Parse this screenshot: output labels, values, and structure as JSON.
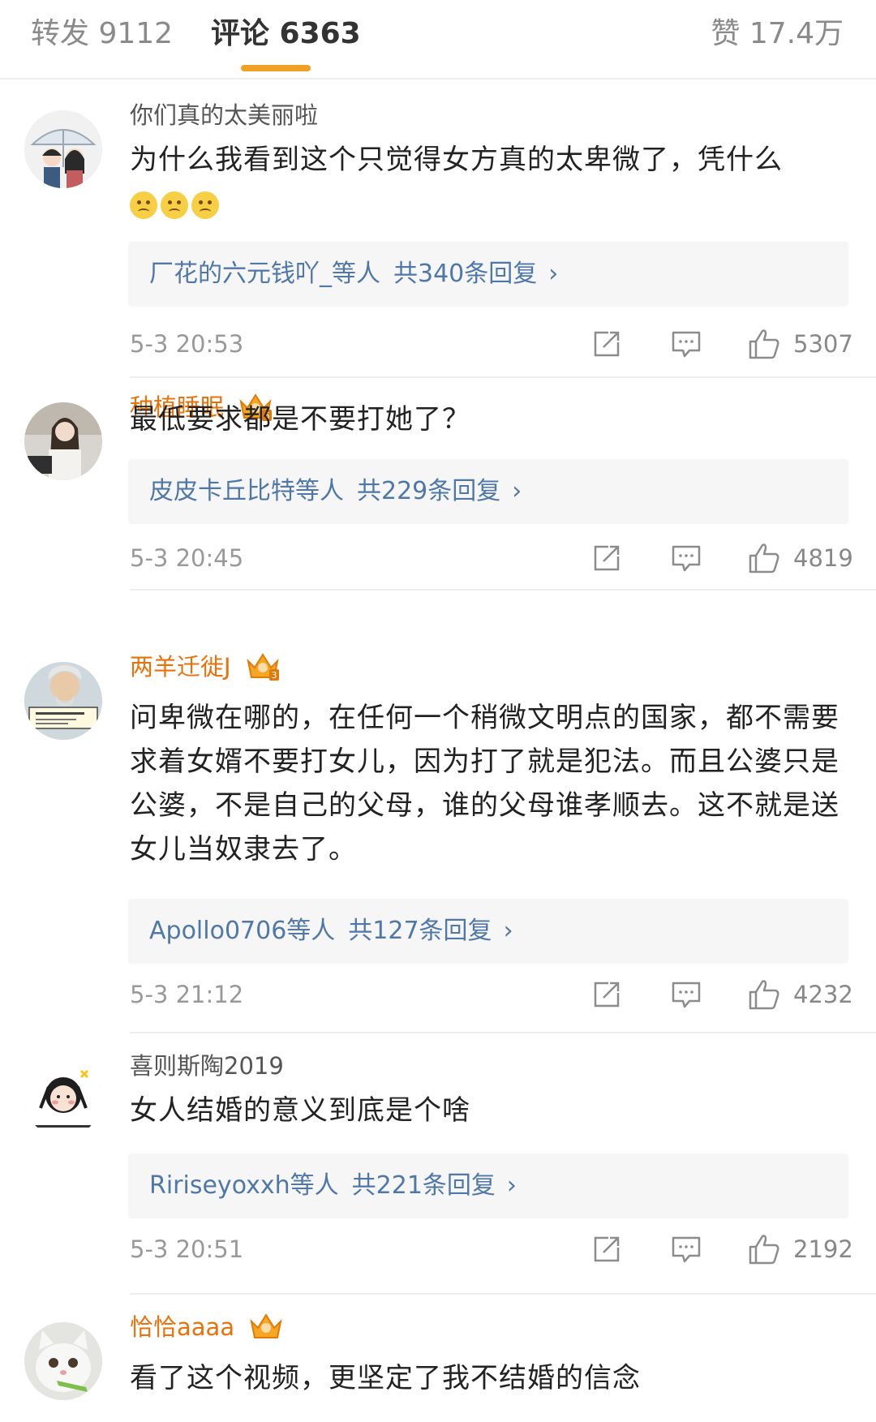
{
  "tabs": {
    "repost": "转发 9112",
    "comments": "评论 6363",
    "likes": "赞 17.4万"
  },
  "comments": [
    {
      "username": "你们真的太美丽啦",
      "vip": false,
      "text": "为什么我看到这个只觉得女方真的太卑微了，凭什么",
      "emoji": [
        "sad-emoji",
        "sad-emoji",
        "sad-emoji"
      ],
      "reply_users": "厂花的六元钱吖_等人",
      "reply_count": "共340条回复",
      "time": "5-3 20:53",
      "likes": "5307"
    },
    {
      "username": "种植睡眠",
      "vip": true,
      "vip_level": "6",
      "text": "最低要求都是不要打她了？",
      "reply_users": "皮皮卡丘比特等人",
      "reply_count": "共229条回复",
      "time": "5-3 20:45",
      "likes": "4819"
    },
    {
      "username": "两羊迁徙J",
      "vip": true,
      "vip_level": "3",
      "text": "问卑微在哪的，在任何一个稍微文明点的国家，都不需要求着女婿不要打女儿，因为打了就是犯法。而且公婆只是公婆，不是自己的父母，谁的父母谁孝顺去。这不就是送女儿当奴隶去了。",
      "reply_users": "Apollo0706等人",
      "reply_count": "共127条回复",
      "time": "5-3 21:12",
      "likes": "4232"
    },
    {
      "username": "喜则斯陶2019",
      "vip": false,
      "text": "女人结婚的意义到底是个啥",
      "reply_users": "Ririseyoxxh等人",
      "reply_count": "共221条回复",
      "time": "5-3 20:51",
      "likes": "2192"
    },
    {
      "username": "恰恰aaaa",
      "vip": true,
      "text": "看了这个视频，更坚定了我不结婚的信念"
    }
  ],
  "chevron": "›",
  "colors": {
    "accent": "#f0a024",
    "vip_name": "#e8710a",
    "link": "#4f78a8",
    "muted": "#999999"
  }
}
